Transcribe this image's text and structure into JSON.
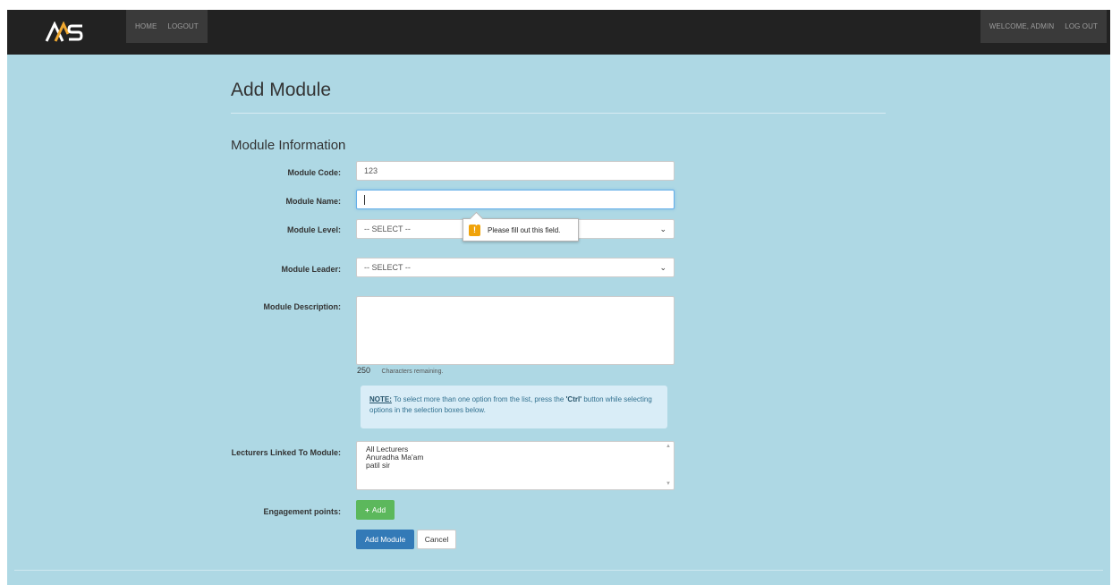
{
  "navbar": {
    "home": "HOME",
    "logout": "LOGOUT",
    "welcome": "WELCOME, ADMIN",
    "log_out": "LOG OUT",
    "brand_color": "#222222"
  },
  "page": {
    "title": "Add Module",
    "section_title": "Module Information",
    "background": "#aed8e4"
  },
  "form": {
    "module_code": {
      "label": "Module Code:",
      "value": "123"
    },
    "module_name": {
      "label": "Module Name:",
      "value": ""
    },
    "module_level": {
      "label": "Module Level:",
      "selected": "-- SELECT --"
    },
    "module_leader": {
      "label": "Module Leader:",
      "selected": "-- SELECT --"
    },
    "module_description": {
      "label": "Module Description:",
      "value": ""
    },
    "char_counter": {
      "count": "250",
      "text": "Characters remaining."
    },
    "note": {
      "label": "NOTE:",
      "text_before": " To select more than one option from the list, press the ",
      "ctrl": "'Ctrl'",
      "text_after": " button while selecting options in the selection boxes below."
    },
    "lecturers": {
      "label": "Lecturers Linked To Module:",
      "options": [
        "All Lecturers",
        "Anuradha Ma'am",
        "patil sir"
      ]
    },
    "engagement": {
      "label": "Engagement points:",
      "add_button": "Add"
    },
    "submit_button": "Add Module",
    "cancel_button": "Cancel"
  },
  "validation_tooltip": {
    "message": "Please fill out this field.",
    "icon": "warning-icon"
  }
}
